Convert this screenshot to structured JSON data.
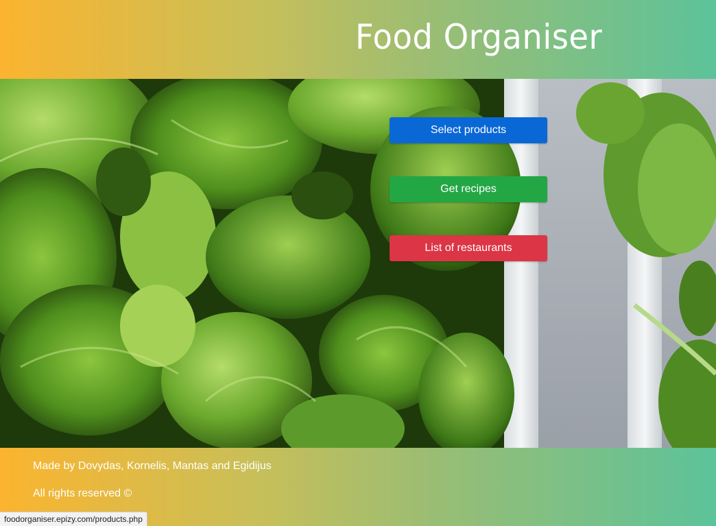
{
  "header": {
    "title": "Food Organiser"
  },
  "actions": {
    "select_products": {
      "label": "Select products",
      "color": "#0a68d6"
    },
    "get_recipes": {
      "label": "Get recipes",
      "color": "#23a745"
    },
    "list_restaurants": {
      "label": "List of restaurants",
      "color": "#dc3545"
    }
  },
  "footer": {
    "credits": "Made by Dovydas, Kornelis, Mantas and Egidijus",
    "rights": "All rights reserved ©"
  },
  "status_bar": {
    "url": "foodorganiser.epizy.com/products.php"
  },
  "theme": {
    "gradient_start": "#fbb42f",
    "gradient_end": "#5cc39a"
  },
  "hero_image": {
    "description_icon": "leafy-greens-photo"
  }
}
